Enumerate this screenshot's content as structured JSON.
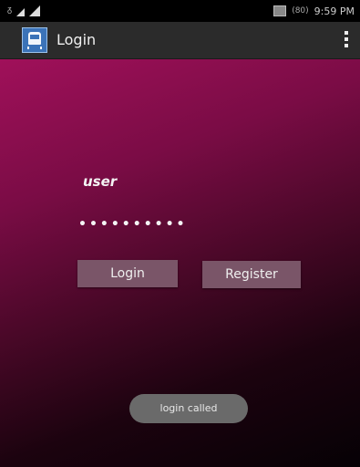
{
  "status_bar": {
    "notification_glyph": "ᵹ",
    "battery_label": "(80)",
    "time": "9:59 PM",
    "icons": [
      "signal-icon",
      "notification-icon",
      "battery-icon"
    ]
  },
  "action_bar": {
    "title": "Login",
    "app_icon": "train-icon",
    "menu_icon": "overflow-menu-icon"
  },
  "form": {
    "username_value": "user",
    "password_value": "••••••••••"
  },
  "buttons": {
    "login_label": "Login",
    "register_label": "Register"
  },
  "toast": {
    "message": "login called"
  },
  "colors": {
    "gradient_top": "#a0105a",
    "gradient_bottom": "#060105",
    "action_bar_bg": "#2b2b2b",
    "button_bg": "#7a5568",
    "toast_bg": "#6a6a6a"
  }
}
